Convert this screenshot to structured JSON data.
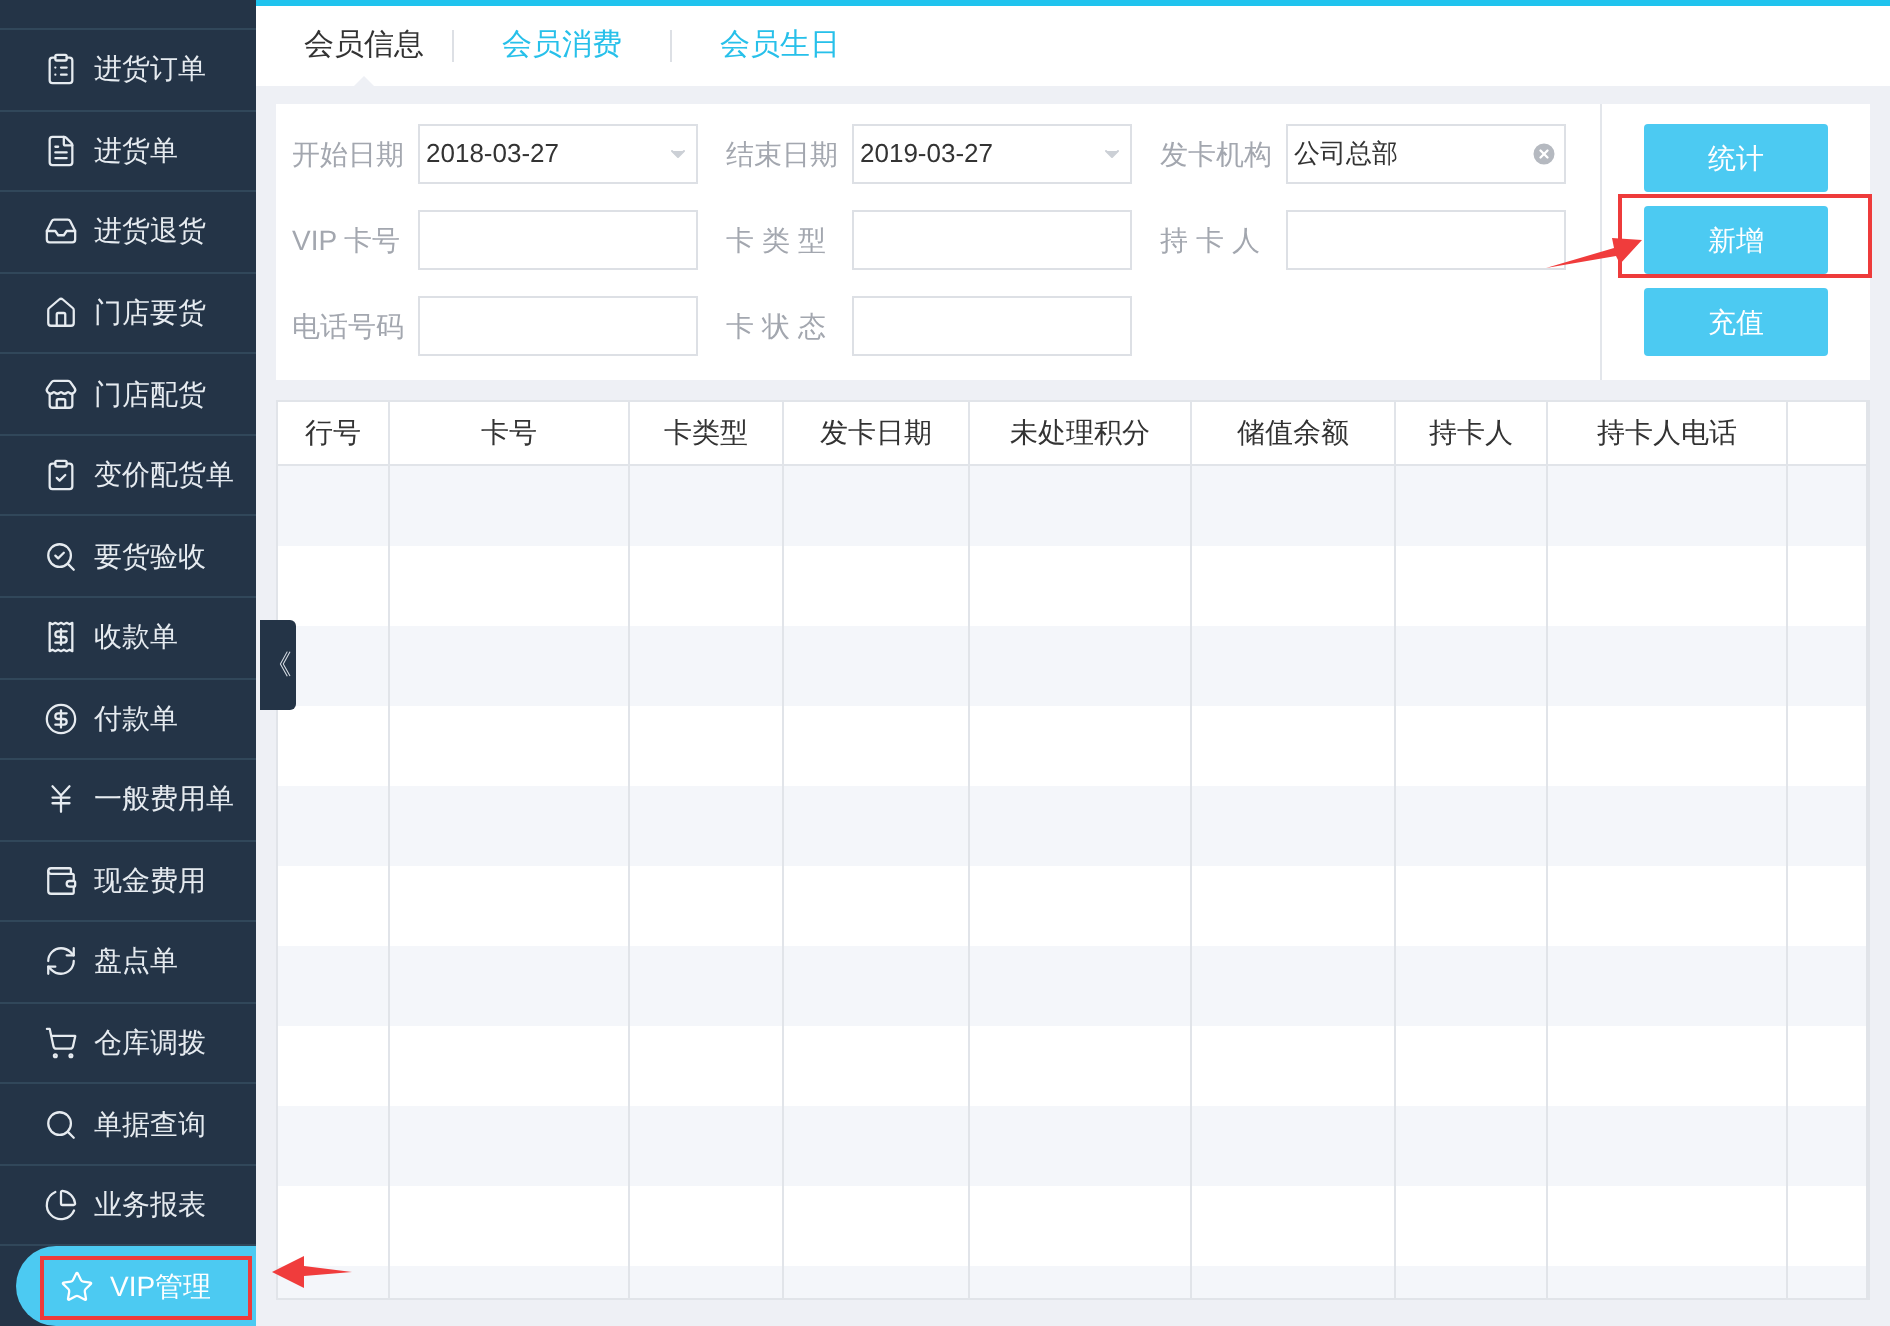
{
  "sidebar": {
    "items": [
      {
        "label": "进货订单",
        "selected": false
      },
      {
        "label": "进货单",
        "selected": false
      },
      {
        "label": "进货退货",
        "selected": false
      },
      {
        "label": "门店要货",
        "selected": false
      },
      {
        "label": "门店配货",
        "selected": false
      },
      {
        "label": "变价配货单",
        "selected": false
      },
      {
        "label": "要货验收",
        "selected": false
      },
      {
        "label": "收款单",
        "selected": false
      },
      {
        "label": "付款单",
        "selected": false
      },
      {
        "label": "一般费用单",
        "selected": false
      },
      {
        "label": "现金费用",
        "selected": false
      },
      {
        "label": "盘点单",
        "selected": false
      },
      {
        "label": "仓库调拨",
        "selected": false
      },
      {
        "label": "单据查询",
        "selected": false
      },
      {
        "label": "业务报表",
        "selected": false
      },
      {
        "label": "VIP管理",
        "selected": true
      }
    ]
  },
  "collapse_button": "《",
  "tabs": [
    {
      "label": "会员信息",
      "selected": true
    },
    {
      "label": "会员消费",
      "selected": false
    },
    {
      "label": "会员生日",
      "selected": false
    }
  ],
  "filters": [
    {
      "label": "开始日期",
      "kind": "date",
      "value": "2018-03-27"
    },
    {
      "label": "结束日期",
      "kind": "date",
      "value": "2019-03-27"
    },
    {
      "label": "发卡机构",
      "kind": "clearable",
      "value": "公司总部"
    },
    {
      "label": "VIP 卡号",
      "kind": "text"
    },
    {
      "label": "卡 类 型",
      "kind": "text"
    },
    {
      "label": "持 卡 人",
      "kind": "text"
    },
    {
      "label": "电话号码",
      "kind": "text"
    },
    {
      "label": "卡 状 态",
      "kind": "text"
    }
  ],
  "buttons": [
    "统计",
    "新增",
    "充值"
  ],
  "table": {
    "columns": [
      "行号",
      "卡号",
      "卡类型",
      "发卡日期",
      "未处理积分",
      "储值余额",
      "持卡人",
      "持卡人电话"
    ]
  }
}
